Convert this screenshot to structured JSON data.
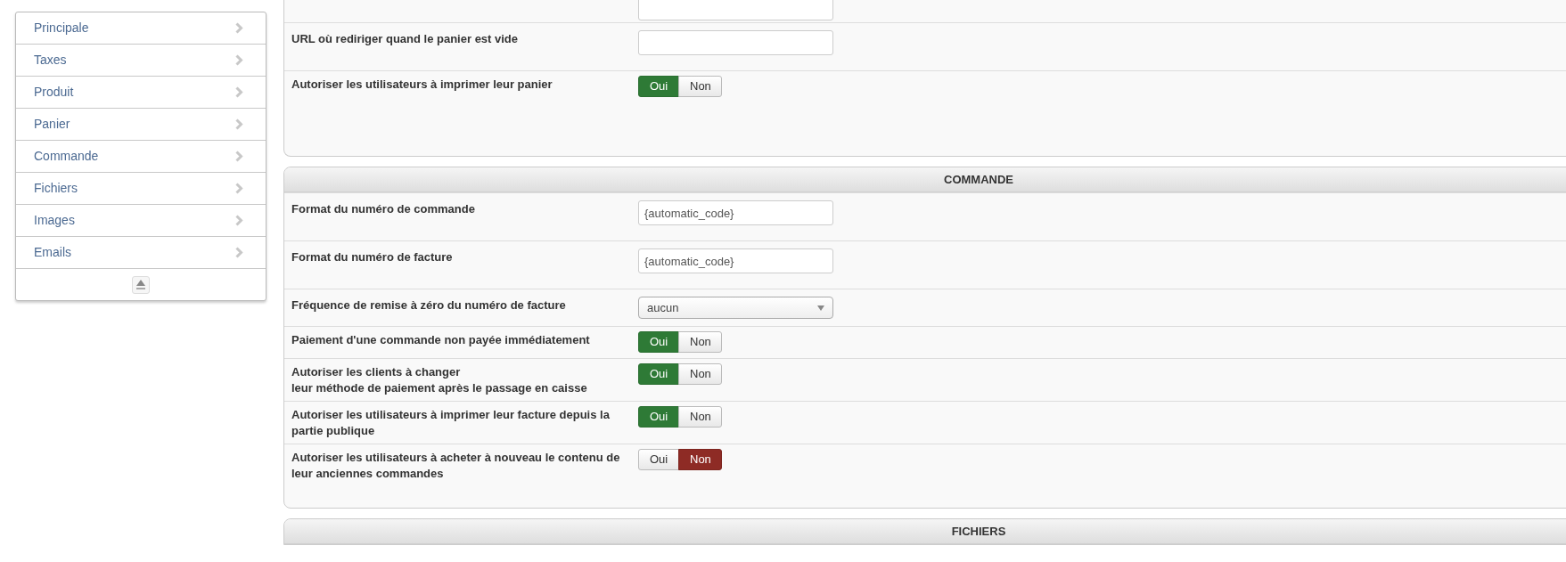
{
  "sidebar": {
    "items": [
      {
        "label": "Principale"
      },
      {
        "label": "Taxes"
      },
      {
        "label": "Produit"
      },
      {
        "label": "Panier"
      },
      {
        "label": "Commande"
      },
      {
        "label": "Fichiers"
      },
      {
        "label": "Images"
      },
      {
        "label": "Emails"
      }
    ]
  },
  "panels": [
    {
      "rows": [
        {
          "kind": "text",
          "label": "URL où rediriger quand le panier est vide",
          "value": ""
        },
        {
          "kind": "toggle",
          "label": "Autoriser les utilisateurs à imprimer leur panier",
          "options": [
            {
              "label": "Oui",
              "selected": true
            },
            {
              "label": "Non",
              "selected": false
            }
          ]
        }
      ]
    },
    {
      "title": "COMMANDE",
      "rows": [
        {
          "kind": "text",
          "label": "Format du numéro de commande",
          "value": "{automatic_code}"
        },
        {
          "kind": "text",
          "label": "Format du numéro de facture",
          "value": "{automatic_code}"
        },
        {
          "kind": "select",
          "label": "Fréquence de remise à zéro du numéro de facture",
          "value": "aucun"
        },
        {
          "kind": "toggle",
          "label": "Paiement d'une commande non payée immédiatement",
          "options": [
            {
              "label": "Oui",
              "selected": true
            },
            {
              "label": "Non",
              "selected": false
            }
          ]
        },
        {
          "kind": "toggle",
          "label": "Autoriser les clients à changer\nleur méthode de paiement après le passage en caisse",
          "options": [
            {
              "label": "Oui",
              "selected": true
            },
            {
              "label": "Non",
              "selected": false
            }
          ]
        },
        {
          "kind": "toggle",
          "label": "Autoriser les utilisateurs à imprimer leur facture depuis la partie publique",
          "options": [
            {
              "label": "Oui",
              "selected": true
            },
            {
              "label": "Non",
              "selected": false
            }
          ]
        },
        {
          "kind": "toggle",
          "label": "Autoriser les utilisateurs à acheter à nouveau le contenu de leur anciennes commandes",
          "options": [
            {
              "label": "Oui",
              "selected": false
            },
            {
              "label": "Non",
              "selected": true
            }
          ]
        }
      ]
    },
    {
      "title": "FICHIERS"
    }
  ]
}
